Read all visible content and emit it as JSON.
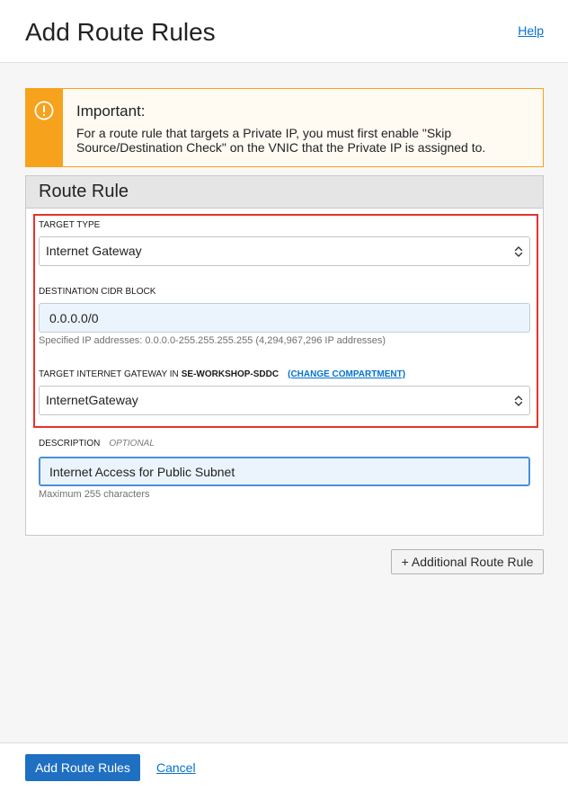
{
  "header": {
    "title": "Add Route Rules",
    "help_label": "Help"
  },
  "alert": {
    "title": "Important:",
    "message": "For a route rule that targets a Private IP, you must first enable \"Skip Source/Destination Check\" on the VNIC that the Private IP is assigned to."
  },
  "route_rule": {
    "title": "Route Rule",
    "target_type": {
      "label": "TARGET TYPE",
      "value": "Internet Gateway"
    },
    "destination_cidr": {
      "label": "DESTINATION CIDR BLOCK",
      "value": "0.0.0.0/0",
      "hint": "Specified IP addresses: 0.0.0.0-255.255.255.255 (4,294,967,296 IP addresses)"
    },
    "target_gateway": {
      "label": "TARGET INTERNET GATEWAY IN",
      "compartment": "SE-WORKSHOP-SDDC",
      "change_compartment_label": "(CHANGE COMPARTMENT)",
      "value": "InternetGateway"
    },
    "description": {
      "label": "DESCRIPTION",
      "optional_label": "OPTIONAL",
      "value": "Internet Access for Public Subnet",
      "hint": "Maximum 255 characters"
    }
  },
  "additional_rule_button": {
    "label": "+ Additional Route Rule"
  },
  "footer": {
    "submit_label": "Add Route Rules",
    "cancel_label": "Cancel"
  },
  "icons": {
    "alert": "alert-circle-icon",
    "select_toggle": "chevron-up-down-icon"
  },
  "colors": {
    "accent": "#0572ce",
    "primary_button": "#1f6fc3",
    "warning": "#f7a21c",
    "highlight": "#e5332a",
    "input_background": "#ebf4fc"
  }
}
